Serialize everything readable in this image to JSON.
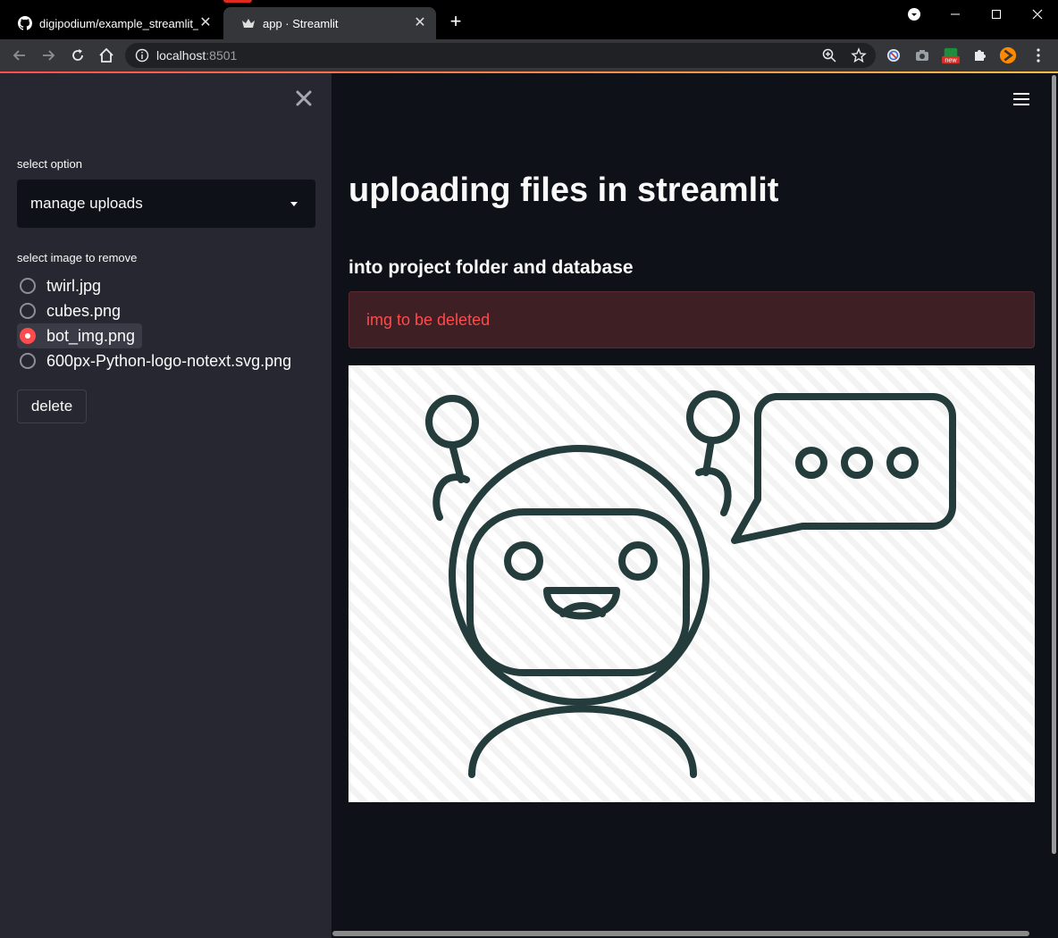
{
  "browser": {
    "tabs": [
      {
        "title": "digipodium/example_streamlit_x",
        "icon": "github-icon",
        "active": false
      },
      {
        "title": "app · Streamlit",
        "icon": "streamlit-crown-icon",
        "active": true
      }
    ],
    "address": {
      "host": "localhost",
      "port": ":8501"
    },
    "extensions": [
      "zoom-icon",
      "bookmark-star-icon",
      "block-icon",
      "camera-icon",
      "new-badge-extension-icon",
      "puzzle-icon",
      "avatar-extension-icon",
      "menu-dots-icon"
    ],
    "new_badge": "new"
  },
  "sidebar": {
    "select_label": "select option",
    "select_value": "manage uploads",
    "radio_label": "select image to remove",
    "options": [
      {
        "label": "twirl.jpg",
        "selected": false
      },
      {
        "label": "cubes.png",
        "selected": false
      },
      {
        "label": "bot_img.png",
        "selected": true
      },
      {
        "label": "600px-Python-logo-notext.svg.png",
        "selected": false
      }
    ],
    "delete_label": "delete"
  },
  "main": {
    "title": "uploading files in streamlit",
    "subtitle": "into project folder and database",
    "alert_text": "img to be deleted",
    "image_name": "bot-image"
  },
  "colors": {
    "accent": "#ff4b4b",
    "sidebar_bg": "#262730",
    "main_bg": "#0e1117",
    "robot_stroke": "#243c3c"
  }
}
